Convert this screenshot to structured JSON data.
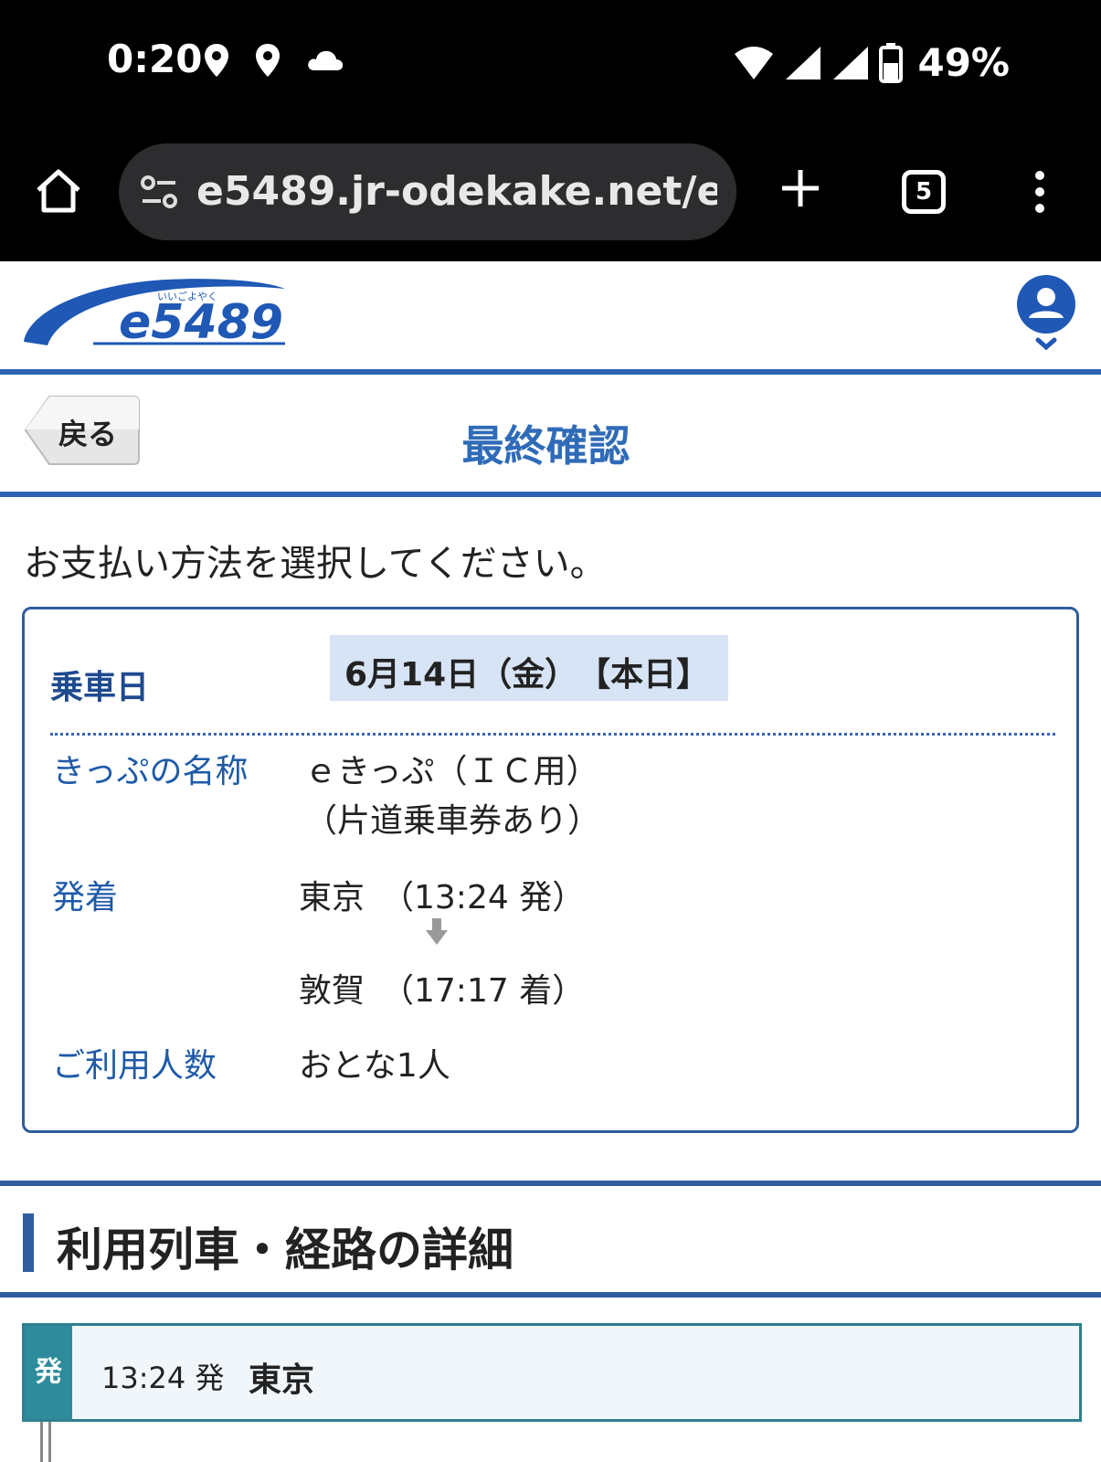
{
  "status_bar": {
    "time": "0:20",
    "battery": "49%"
  },
  "browser": {
    "url": "e5489.jr-odekake.net/e5489",
    "tab_count": "5"
  },
  "site": {
    "logo_text": "e5489",
    "logo_ruby": "いいごよやく"
  },
  "page": {
    "back_label": "戻る",
    "title": "最終確認",
    "instruction": "お支払い方法を選択してください。"
  },
  "summary": {
    "date_label": "乗車日",
    "date_value": "6月14日（金）　【本日】",
    "ticket_label": "きっぷの名称",
    "ticket_value_line1": "ｅきっぷ（ＩＣ用）",
    "ticket_value_line2": "（片道乗車券あり）",
    "route_label": "発着",
    "from_value": "東京　（13:24 発）",
    "to_value": "敦賀　（17:17 着）",
    "passengers_label": "ご利用人数",
    "passengers_value": "おとな1人"
  },
  "route_section": {
    "title": "利用列車・経路の詳細",
    "departure_tag": "発",
    "departure_time": "13:24 発",
    "departure_station": "東京"
  },
  "colors": {
    "brand_blue": "#2f63b3",
    "title_blue": "#2f6bb8",
    "date_highlight": "#d7e4f5",
    "departure_tag": "#2d8b9b"
  }
}
